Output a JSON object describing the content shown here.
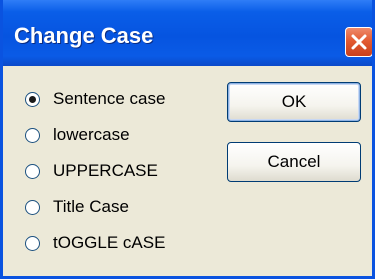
{
  "dialog": {
    "title": "Change Case",
    "close_icon": "close-x-icon"
  },
  "options": [
    {
      "label": "Sentence case",
      "selected": true
    },
    {
      "label": "lowercase",
      "selected": false
    },
    {
      "label": "UPPERCASE",
      "selected": false
    },
    {
      "label": "Title Case",
      "selected": false
    },
    {
      "label": "tOGGLE cASE",
      "selected": false
    }
  ],
  "buttons": {
    "ok_label": "OK",
    "cancel_label": "Cancel"
  },
  "colors": {
    "titlebar": "#0654e0",
    "close_button": "#e35b33",
    "dialog_background": "#ece9d8"
  }
}
